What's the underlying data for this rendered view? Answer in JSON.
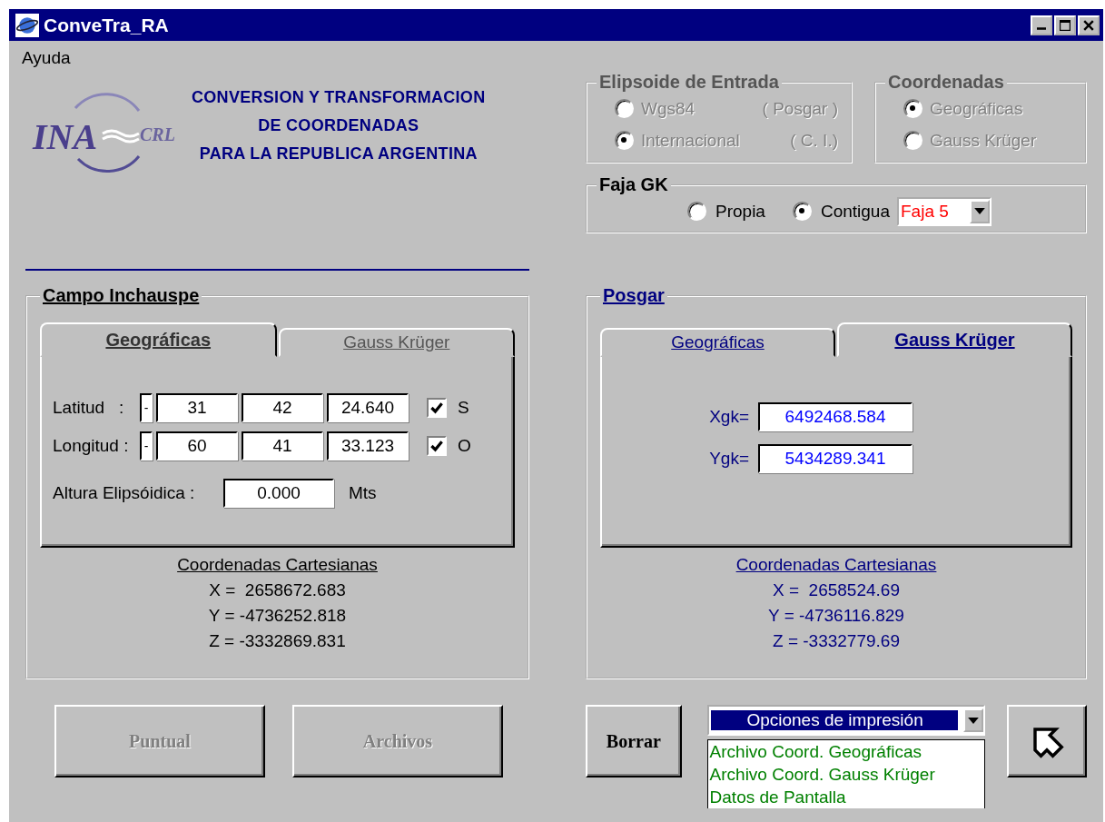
{
  "window": {
    "title": "ConveTra_RA"
  },
  "menu": [
    {
      "label": "Ayuda"
    }
  ],
  "logo": {
    "main": "INA",
    "sub": "CRL"
  },
  "heading": [
    "CONVERSION Y TRANSFORMACION",
    "DE COORDENADAS",
    "PARA LA REPUBLICA ARGENTINA"
  ],
  "ellipsoid": {
    "title": "Elipsoide de Entrada",
    "disabled": true,
    "options": [
      {
        "label": "Wgs84",
        "note": "( Posgar )",
        "selected": false
      },
      {
        "label": "Internacional",
        "note": "( C. I.)",
        "selected": true
      }
    ]
  },
  "coordinates": {
    "title": "Coordenadas",
    "disabled": true,
    "options": [
      {
        "label": "Geográficas",
        "selected": true
      },
      {
        "label": "Gauss Krüger",
        "selected": false
      }
    ]
  },
  "faja": {
    "title": "Faja GK",
    "options": [
      {
        "label": "Propia",
        "selected": false
      },
      {
        "label": "Contigua",
        "selected": true
      }
    ],
    "combo": "Faja 5"
  },
  "input_panel": {
    "title": "Campo Inchauspe",
    "tabs": [
      {
        "label": "Geográficas",
        "selected": true
      },
      {
        "label": "Gauss Krüger",
        "selected": false
      }
    ],
    "rows": [
      {
        "label": "Latitud   :",
        "sign": "-",
        "deg": "31",
        "min": "42",
        "sec": "24.640",
        "checked": true,
        "hemisphere": "S"
      },
      {
        "label": "Longitud :",
        "sign": "-",
        "deg": "60",
        "min": "41",
        "sec": "33.123",
        "checked": true,
        "hemisphere": "O"
      }
    ],
    "height": {
      "label": "Altura Elipsóidica :",
      "value": "0.000",
      "unit": "Mts"
    },
    "cartesian_title": "Coordenadas Cartesianas",
    "cartesian": [
      "X =  2658672.683",
      "Y = -4736252.818",
      "Z = -3332869.831"
    ]
  },
  "output_panel": {
    "title": "Posgar",
    "tabs": [
      {
        "label": "Geográficas",
        "selected": false
      },
      {
        "label": "Gauss Krüger",
        "selected": true
      }
    ],
    "fields": [
      {
        "label": "Xgk=",
        "value": "6492468.584"
      },
      {
        "label": "Ygk=",
        "value": "5434289.341"
      }
    ],
    "cartesian_title": "Coordenadas Cartesianas",
    "cartesian": [
      "X =  2658524.69",
      "Y = -4736116.829",
      "Z = -3332779.69"
    ]
  },
  "buttons": [
    {
      "label": "Puntual",
      "disabled": true
    },
    {
      "label": "Archivos",
      "disabled": true
    },
    {
      "label": "Borrar",
      "disabled": false
    }
  ],
  "print": {
    "value": "Opciones de impresión",
    "options": [
      "Archivo Coord. Geográficas",
      "Archivo Coord. Gauss Krüger",
      "Datos de Pantalla"
    ]
  }
}
